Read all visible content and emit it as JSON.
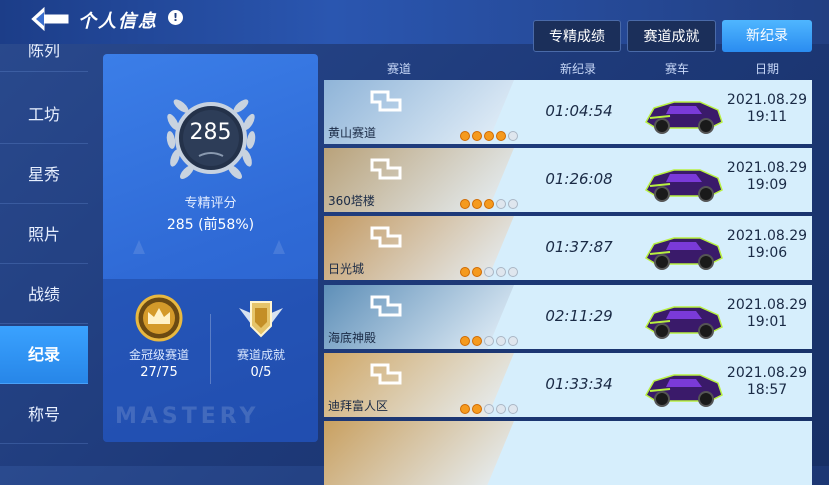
{
  "header": {
    "title": "个人信息",
    "info_glyph": "!"
  },
  "tabs": [
    {
      "label": "专精成绩",
      "active": false
    },
    {
      "label": "赛道成就",
      "active": false
    },
    {
      "label": "新纪录",
      "active": true
    }
  ],
  "sidebar": {
    "items": [
      {
        "label": "陈列",
        "active": false
      },
      {
        "label": "工坊",
        "active": false
      },
      {
        "label": "星秀",
        "active": false
      },
      {
        "label": "照片",
        "active": false
      },
      {
        "label": "战绩",
        "active": false
      },
      {
        "label": "纪录",
        "active": true
      },
      {
        "label": "称号",
        "active": false
      }
    ]
  },
  "profile": {
    "score": "285",
    "rating_label": "专精评分",
    "rating_value": "285 (前58%)",
    "watermark": "MASTERY",
    "achievements": [
      {
        "label": "金冠级赛道",
        "value": "27/75"
      },
      {
        "label": "赛道成就",
        "value": "0/5"
      }
    ]
  },
  "table": {
    "headers": {
      "track": "赛道",
      "record": "新纪录",
      "car": "赛车",
      "date": "日期"
    },
    "rows": [
      {
        "track": "黄山赛道",
        "time": "01:04:54",
        "date": "2021.08.29",
        "clock": "19:11",
        "stars": 4,
        "thumb_color": "#8fb4d8"
      },
      {
        "track": "360塔楼",
        "time": "01:26:08",
        "date": "2021.08.29",
        "clock": "19:09",
        "stars": 3,
        "thumb_color": "#b9a27a"
      },
      {
        "track": "日光城",
        "time": "01:37:87",
        "date": "2021.08.29",
        "clock": "19:06",
        "stars": 2,
        "thumb_color": "#c49a62"
      },
      {
        "track": "海底神殿",
        "time": "02:11:29",
        "date": "2021.08.29",
        "clock": "19:01",
        "stars": 2,
        "thumb_color": "#5e8fb8"
      },
      {
        "track": "迪拜富人区",
        "time": "01:33:34",
        "date": "2021.08.29",
        "clock": "18:57",
        "stars": 2,
        "thumb_color": "#d0a868"
      },
      {
        "track": "",
        "time": "",
        "date": "",
        "clock": "",
        "stars": 0,
        "thumb_color": "#c9a060"
      }
    ]
  },
  "colors": {
    "accent": "#2a8cf0",
    "star_on": "#f59a1e",
    "row_bg": "#d6eefc"
  }
}
